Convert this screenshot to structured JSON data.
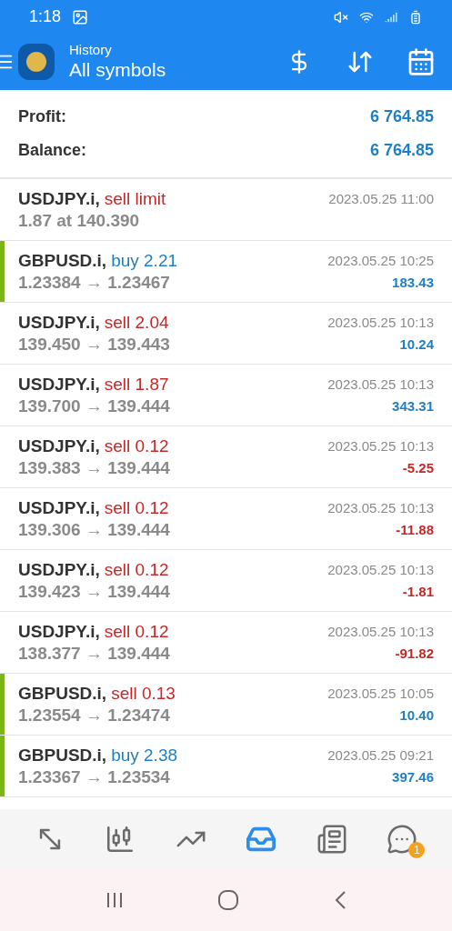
{
  "status_bar": {
    "time": "1:18"
  },
  "app_bar": {
    "title": "History",
    "subtitle": "All symbols"
  },
  "summary": [
    {
      "label": "Profit:",
      "value": "6 764.85"
    },
    {
      "label": "Balance:",
      "value": "6 764.85"
    }
  ],
  "deals": [
    {
      "symbol": "USDJPY.i,",
      "action": "sell limit",
      "kind": "sell",
      "marked": false,
      "prices": "1.87 at 140.390",
      "time": "2023.05.25 11:00"
    },
    {
      "symbol": "GBPUSD.i,",
      "action": "buy 2.21",
      "kind": "buy",
      "marked": true,
      "prices": "1.23384 → 1.23467",
      "time": "2023.05.25 10:25",
      "profit": {
        "text": "183.43",
        "kind": "gain"
      }
    },
    {
      "symbol": "USDJPY.i,",
      "action": "sell 2.04",
      "kind": "sell",
      "marked": false,
      "prices": "139.450 → 139.443",
      "time": "2023.05.25 10:13",
      "profit": {
        "text": "10.24",
        "kind": "gain"
      }
    },
    {
      "symbol": "USDJPY.i,",
      "action": "sell 1.87",
      "kind": "sell",
      "marked": false,
      "prices": "139.700 → 139.444",
      "time": "2023.05.25 10:13",
      "profit": {
        "text": "343.31",
        "kind": "gain"
      }
    },
    {
      "symbol": "USDJPY.i,",
      "action": "sell 0.12",
      "kind": "sell",
      "marked": false,
      "prices": "139.383 → 139.444",
      "time": "2023.05.25 10:13",
      "profit": {
        "text": "-5.25",
        "kind": "loss"
      }
    },
    {
      "symbol": "USDJPY.i,",
      "action": "sell 0.12",
      "kind": "sell",
      "marked": false,
      "prices": "139.306 → 139.444",
      "time": "2023.05.25 10:13",
      "profit": {
        "text": "-11.88",
        "kind": "loss"
      }
    },
    {
      "symbol": "USDJPY.i,",
      "action": "sell 0.12",
      "kind": "sell",
      "marked": false,
      "prices": "139.423 → 139.444",
      "time": "2023.05.25 10:13",
      "profit": {
        "text": "-1.81",
        "kind": "loss"
      }
    },
    {
      "symbol": "USDJPY.i,",
      "action": "sell 0.12",
      "kind": "sell",
      "marked": false,
      "prices": "138.377 → 139.444",
      "time": "2023.05.25 10:13",
      "profit": {
        "text": "-91.82",
        "kind": "loss"
      }
    },
    {
      "symbol": "GBPUSD.i,",
      "action": "sell 0.13",
      "kind": "sell",
      "marked": true,
      "prices": "1.23554 → 1.23474",
      "time": "2023.05.25 10:05",
      "profit": {
        "text": "10.40",
        "kind": "gain"
      }
    },
    {
      "symbol": "GBPUSD.i,",
      "action": "buy 2.38",
      "kind": "buy",
      "marked": true,
      "prices": "1.23367 → 1.23534",
      "time": "2023.05.25 09:21",
      "profit": {
        "text": "397.46",
        "kind": "gain"
      }
    }
  ],
  "bottom_nav": [
    {
      "kind": "trade",
      "selected": false
    },
    {
      "kind": "chart",
      "selected": false
    },
    {
      "kind": "trend",
      "selected": false
    },
    {
      "kind": "history",
      "selected": true
    },
    {
      "kind": "news",
      "selected": false
    },
    {
      "kind": "chat",
      "selected": false,
      "badge": "1"
    }
  ]
}
